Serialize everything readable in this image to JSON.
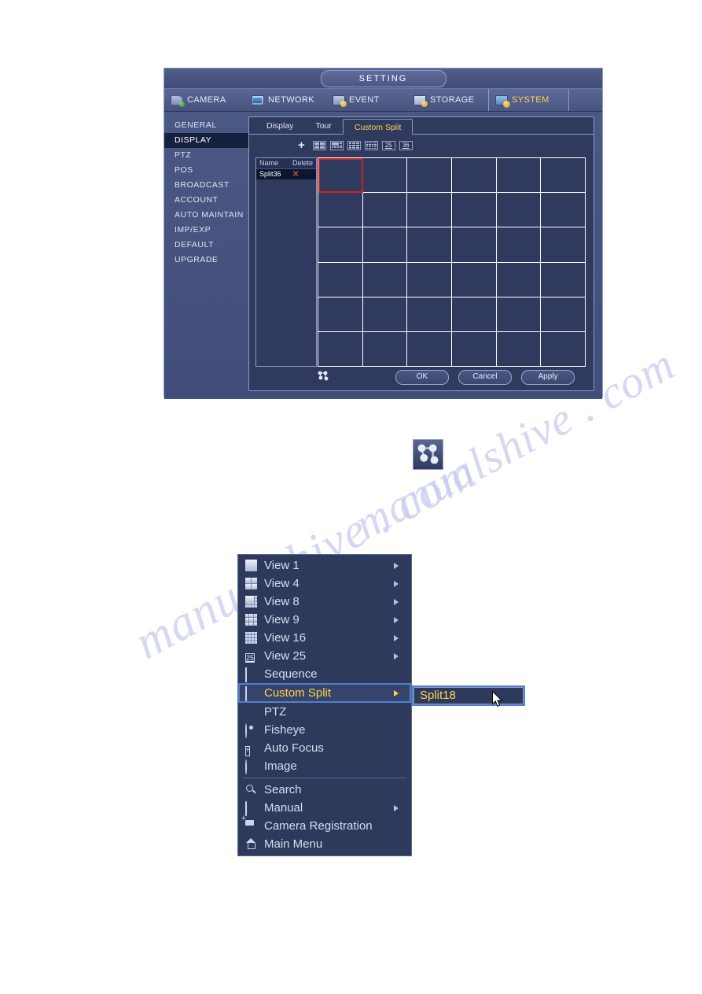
{
  "setting_window": {
    "title": "SETTING",
    "top_tabs": [
      {
        "label": "CAMERA",
        "icon": "camera-icon",
        "active": false
      },
      {
        "label": "NETWORK",
        "icon": "network-icon",
        "active": false
      },
      {
        "label": "EVENT",
        "icon": "event-icon",
        "active": false
      },
      {
        "label": "STORAGE",
        "icon": "storage-icon",
        "active": false
      },
      {
        "label": "SYSTEM",
        "icon": "system-icon",
        "active": true
      }
    ],
    "left_menu": [
      {
        "label": "GENERAL",
        "active": false
      },
      {
        "label": "DISPLAY",
        "active": true
      },
      {
        "label": "PTZ",
        "active": false
      },
      {
        "label": "POS",
        "active": false
      },
      {
        "label": "BROADCAST",
        "active": false
      },
      {
        "label": "ACCOUNT",
        "active": false
      },
      {
        "label": "AUTO MAINTAIN",
        "active": false
      },
      {
        "label": "IMP/EXP",
        "active": false
      },
      {
        "label": "DEFAULT",
        "active": false
      },
      {
        "label": "UPGRADE",
        "active": false
      }
    ],
    "sub_tabs": [
      {
        "label": "Display",
        "active": false
      },
      {
        "label": "Tour",
        "active": false
      },
      {
        "label": "Custom Split",
        "active": true
      }
    ],
    "toolbar": {
      "add_label": "+",
      "split_presets": [
        {
          "name": "split-4-icon",
          "label": "4"
        },
        {
          "name": "split-8-icon",
          "label": "8"
        },
        {
          "name": "split-9-icon",
          "label": "9"
        },
        {
          "name": "split-16-icon",
          "label": "16"
        },
        {
          "name": "split-25-icon",
          "label": "25"
        },
        {
          "name": "split-36-icon",
          "label": "36"
        }
      ]
    },
    "split_list": {
      "columns": [
        "Name",
        "Delete"
      ],
      "rows": [
        {
          "name": "Split36",
          "delete": "✕"
        }
      ]
    },
    "grid": {
      "rows": 6,
      "cols": 6,
      "selected_cell": 0,
      "selection_color": "#c82424"
    },
    "footer": {
      "merge_icon": "merge-cells-icon",
      "buttons": [
        {
          "label": "OK"
        },
        {
          "label": "Cancel"
        },
        {
          "label": "Apply"
        }
      ]
    }
  },
  "standalone_icon": {
    "name": "merge-cells-icon"
  },
  "context_menu": {
    "items": [
      {
        "label": "View 1",
        "icon": "view-1-icon",
        "arrow": true,
        "selected": false
      },
      {
        "label": "View 4",
        "icon": "view-4-icon",
        "arrow": true,
        "selected": false
      },
      {
        "label": "View 8",
        "icon": "view-8-icon",
        "arrow": true,
        "selected": false
      },
      {
        "label": "View 9",
        "icon": "view-9-icon",
        "arrow": true,
        "selected": false
      },
      {
        "label": "View 16",
        "icon": "view-16-icon",
        "arrow": true,
        "selected": false
      },
      {
        "label": "View 25",
        "icon": "view-25-icon",
        "arrow": true,
        "selected": false
      },
      {
        "label": "Sequence",
        "icon": "sequence-icon",
        "arrow": false,
        "selected": false
      },
      {
        "label": "Custom Split",
        "icon": "custom-split-icon",
        "arrow": true,
        "selected": true
      },
      {
        "label": "PTZ",
        "icon": "ptz-icon",
        "arrow": false,
        "selected": false
      },
      {
        "label": "Fisheye",
        "icon": "fisheye-icon",
        "arrow": false,
        "selected": false
      },
      {
        "label": "Auto Focus",
        "icon": "auto-focus-icon",
        "arrow": false,
        "selected": false
      },
      {
        "label": "Image",
        "icon": "image-icon",
        "arrow": false,
        "selected": false
      },
      {
        "label": "Search",
        "icon": "search-icon",
        "arrow": false,
        "selected": false
      },
      {
        "label": "Manual",
        "icon": "mouse-icon",
        "arrow": true,
        "selected": false
      },
      {
        "label": "Camera Registration",
        "icon": "camera-add-icon",
        "arrow": false,
        "selected": false
      },
      {
        "label": "Main Menu",
        "icon": "home-icon",
        "arrow": false,
        "selected": false
      }
    ],
    "separator_after_index": 11
  },
  "submenu": {
    "items": [
      {
        "label": "Split18",
        "selected": true
      }
    ]
  },
  "watermark": {
    "line1": "manualshive . com",
    "line2": "manualshive . com"
  },
  "colors": {
    "accent_yellow": "#ffd24a",
    "selection_blue": "#4f7fd0",
    "grid_selection_red": "#c82424",
    "menu_bg": "#2e3a5c",
    "panel_bg": "#2f3a5e",
    "window_bg": "#44517e"
  }
}
